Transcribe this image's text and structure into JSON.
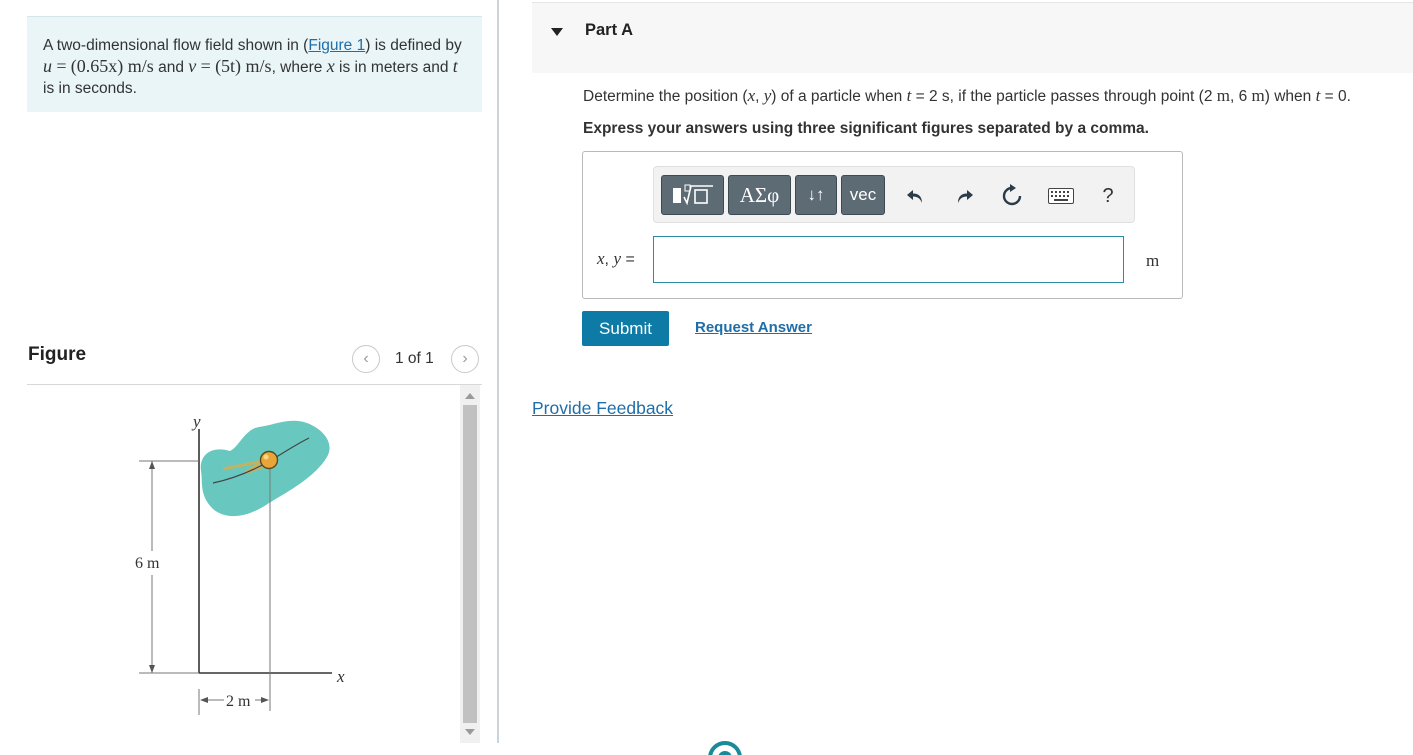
{
  "problem": {
    "text_before_link": "A two-dimensional flow field shown in (",
    "figure_link": "Figure 1",
    "text_after_link": ") is defined by",
    "u_var": "u",
    "eq1": "=",
    "u_expr": "(0.65x) m/s",
    "and_word": "and",
    "v_var": "v",
    "eq2": "=",
    "v_expr": "(5t) m/s",
    "where_text": ", where",
    "x_var": "x",
    "is_in_text": "is in meters and",
    "t_var": "t",
    "tail_text": "is in seconds."
  },
  "figure_panel": {
    "heading": "Figure",
    "pager": "1 of 1",
    "prev_icon": "chevron-left-icon",
    "next_icon": "chevron-right-icon",
    "labels": {
      "y_axis": "y",
      "x_axis": "x",
      "height": "6 m",
      "width": "2 m"
    },
    "colors": {
      "flow_region": "#58c2b8",
      "particle": "#e9a53a",
      "wake": "#e8a83b"
    }
  },
  "part": {
    "title": "Part A",
    "toggle_icon": "caret-down-icon",
    "question": {
      "before": "Determine the position (",
      "x": "x",
      "comma": ",",
      "y": "y",
      "mid1": ") of a particle when",
      "t1": "t",
      "eq1": "= 2 s, if the particle passes through point (2",
      "m1": "m",
      "comma2": ", 6",
      "m2": "m",
      "mid2": ") when",
      "t2": "t",
      "eq2": "= 0."
    },
    "instruction": "Express your answers using three significant figures separated by a comma.",
    "toolbar": {
      "templates_icon": "math-templates-icon",
      "greek_label": "ΑΣφ",
      "arrows_label": "↓↑",
      "vec_label": "vec",
      "undo_icon": "undo-icon",
      "redo_icon": "redo-icon",
      "reset_icon": "reset-icon",
      "keyboard_icon": "keyboard-icon",
      "help_label": "?"
    },
    "answer": {
      "label_x": "x",
      "label_sep": ",",
      "label_y": "y",
      "label_eq": "=",
      "value": "",
      "placeholder": "",
      "unit": "m"
    },
    "submit_label": "Submit",
    "request_answer_label": "Request Answer"
  },
  "feedback_label": "Provide Feedback",
  "colors": {
    "accent": "#0e7aa6",
    "link": "#1f6ea8",
    "problem_bg": "#e9f5f7",
    "toolbar_button": "#5d6b75"
  }
}
